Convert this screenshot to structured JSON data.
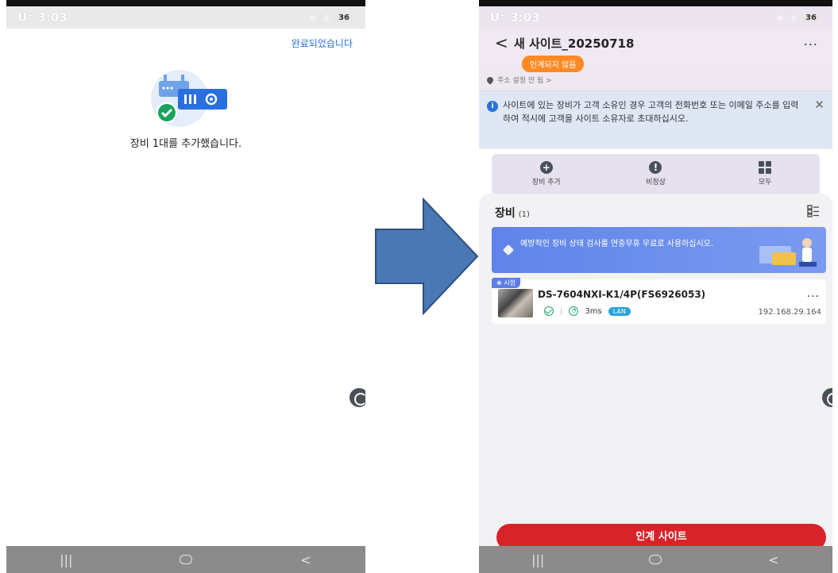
{
  "left_screen": {
    "status": {
      "time": "3:03",
      "carrier": "U⁺",
      "battery": "36"
    },
    "done_label": "완료되었습니다",
    "message": "장비 1대를 추가했습니다.",
    "nav": {
      "recent": "|||",
      "back": "<"
    }
  },
  "right_screen": {
    "status": {
      "time": "3:03",
      "carrier": "U⁺",
      "battery": "36"
    },
    "header": {
      "back": "<",
      "title": "새 사이트_20250718",
      "more": "...",
      "badge": "인계되지 않음",
      "address": "주소 설정 안 됨 >"
    },
    "info_banner": {
      "icon": "i",
      "text": "사이트에 있는 장비가 고객 소유인 경우 고객의 전화번호 또는 이메일 주소를 입력하여 적시에 고객을 사이트 소유자로 초대하십시오.",
      "close": "✕"
    },
    "actions": [
      {
        "label": "장비 추가",
        "icon": "+"
      },
      {
        "label": "비정상",
        "icon": "!"
      },
      {
        "label": "모두",
        "icon": "grid-icon"
      }
    ],
    "devices_section": {
      "title": "장비",
      "count": "(1)"
    },
    "promo": {
      "text": "예방적인 장비 상태 검사를 연중무휴 무료로 사용하십시오."
    },
    "device": {
      "tag": "시험",
      "name": "DS-7604NXI-K1/4P(FS6926053)",
      "more": "...",
      "ping": "3ms",
      "network": "LAN",
      "ip": "192.168.29.164"
    },
    "cta_label": "인계 사이트",
    "nav": {
      "recent": "|||",
      "back": "<"
    }
  },
  "colors": {
    "accent_blue": "#2a6fe0",
    "arrow_fill": "#4a78b5",
    "badge_orange": "#ff8a23",
    "cta_red": "#d9232a",
    "ok_green": "#18a76b",
    "lan_blue": "#2aa3db"
  }
}
